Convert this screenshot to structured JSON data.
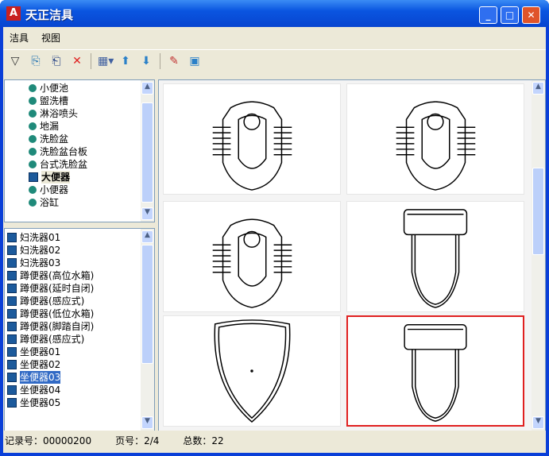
{
  "window": {
    "title": "天正洁具",
    "min": "_",
    "max": "□",
    "close": "✕"
  },
  "menu": [
    "洁具",
    "视图"
  ],
  "toolbar": [
    "filter-icon",
    "import-icon",
    "export-icon",
    "delete-icon",
    "view-mode-icon",
    "up-icon",
    "down-icon",
    "edit-icon",
    "preview-icon"
  ],
  "tree": [
    {
      "label": "小便池"
    },
    {
      "label": "盥洗槽"
    },
    {
      "label": "淋浴喷头"
    },
    {
      "label": "地漏"
    },
    {
      "label": "洗脸盆"
    },
    {
      "label": "洗脸盆台板"
    },
    {
      "label": "台式洗脸盆"
    },
    {
      "label": "大便器",
      "selected": true
    },
    {
      "label": "小便器"
    },
    {
      "label": "浴缸"
    }
  ],
  "list": [
    "妇洗器01",
    "妇洗器02",
    "妇洗器03",
    "蹲便器(高位水箱)",
    "蹲便器(延时自闭)",
    "蹲便器(感应式)",
    "蹲便器(低位水箱)",
    "蹲便器(脚踏自闭)",
    "蹲便器(感应式)",
    "坐便器01",
    "坐便器02",
    "坐便器03",
    "坐便器04",
    "坐便器05"
  ],
  "list_selected": 11,
  "status": {
    "record": "记录号：00000200",
    "page": "页号：2/4",
    "total": "总数：22"
  },
  "selection_color": "#e02020"
}
